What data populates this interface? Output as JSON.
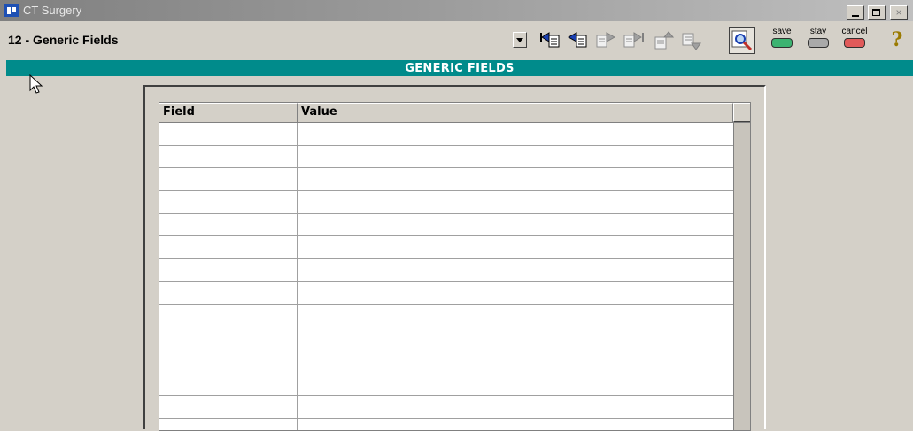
{
  "window": {
    "title": "CT Surgery",
    "buttons": {
      "close": "×"
    }
  },
  "toolbar": {
    "screen_select": "12 - Generic Fields",
    "icons": [
      "first-record-icon",
      "previous-record-icon",
      "next-record-icon",
      "last-record-icon",
      "move-up-icon",
      "move-down-icon",
      "search-icon"
    ],
    "save_label": "save",
    "stay_label": "stay",
    "cancel_label": "cancel",
    "help": "?"
  },
  "section": {
    "title": "GENERIC FIELDS"
  },
  "grid": {
    "columns": [
      "Field",
      "Value"
    ],
    "rows": [
      [
        "",
        ""
      ],
      [
        "",
        ""
      ],
      [
        "",
        ""
      ],
      [
        "",
        ""
      ],
      [
        "",
        ""
      ],
      [
        "",
        ""
      ],
      [
        "",
        ""
      ],
      [
        "",
        ""
      ],
      [
        "",
        ""
      ],
      [
        "",
        ""
      ],
      [
        "",
        ""
      ],
      [
        "",
        ""
      ],
      [
        "",
        ""
      ],
      [
        "",
        ""
      ]
    ]
  },
  "colors": {
    "accent": "#008b8b",
    "save": "#3cb371",
    "stay": "#a9a9a9",
    "cancel": "#e05a5a"
  }
}
